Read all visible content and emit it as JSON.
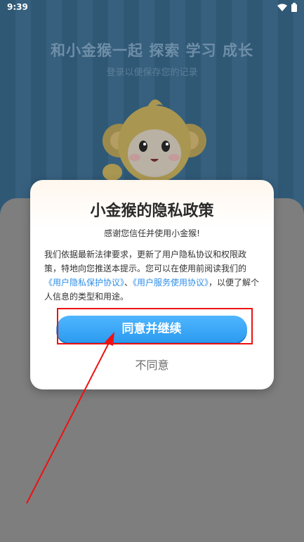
{
  "status_bar": {
    "time": "9:39"
  },
  "background": {
    "headline": "和小金猴一起 探索 学习 成长",
    "subline": "登录以便保存您的记录"
  },
  "dialog": {
    "title": "小金猴的隐私政策",
    "thanks": "感谢您信任并使用小金猴!",
    "body_1": "我们依据最新法律要求，更新了用户隐私协议和权限政策，特地向您推送本提示。您可以在使用前阅读我们的",
    "link_privacy": "《用户隐私保护协议》",
    "sep": "、",
    "link_service": "《用户服务使用协议》",
    "body_2": "，以便了解个人信息的类型和用途。",
    "agree_label": "同意并继续",
    "disagree_label": "不同意"
  },
  "colors": {
    "accent_blue": "#2c9bf0",
    "link_blue": "#2e8ee8",
    "highlight_red": "#ee1111"
  }
}
